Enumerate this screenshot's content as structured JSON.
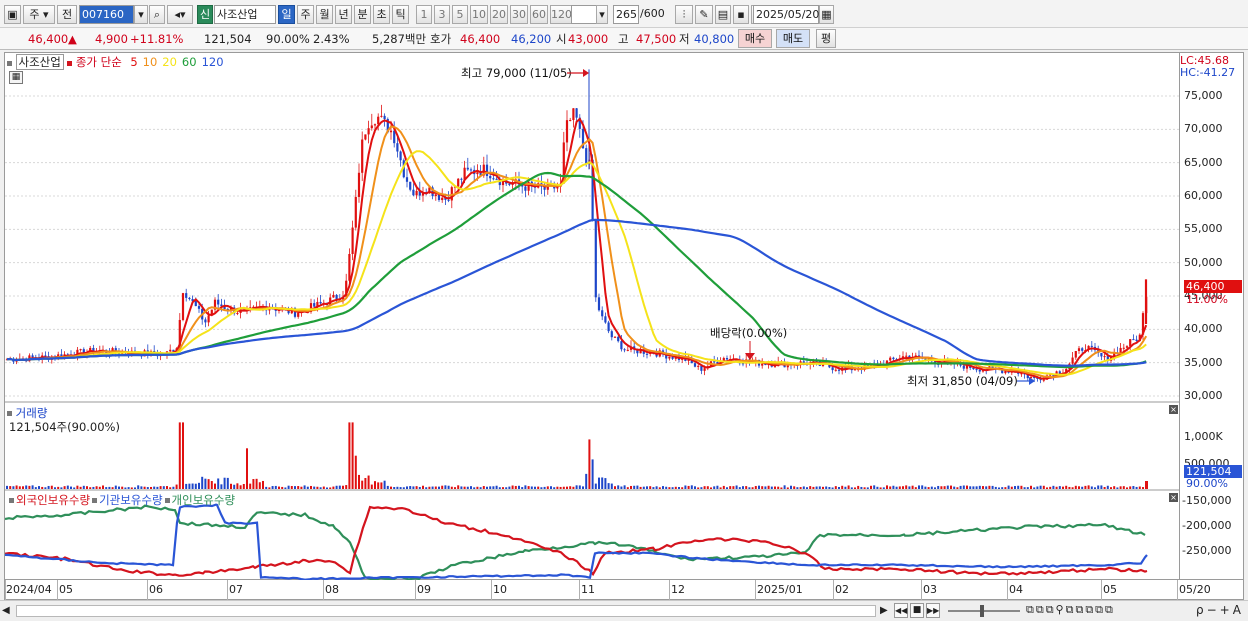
{
  "toolbar": {
    "type_label": "주",
    "prev_label": "전",
    "code": "007160",
    "stock_badge": "신",
    "stock_name": "사조산업",
    "periods": [
      "일",
      "주",
      "월",
      "년",
      "분",
      "초",
      "틱"
    ],
    "active_period": "일",
    "intervals": [
      "1",
      "3",
      "5",
      "10",
      "20",
      "30",
      "60",
      "120"
    ],
    "count": "265",
    "count_total": "/600",
    "date": "2025/05/20"
  },
  "quote": {
    "price": "46,400",
    "change": "4,900",
    "change_pct": "+11.81%",
    "volume": "121,504",
    "vol_ratio": "90.00%",
    "turnover": "2.43%",
    "amount": "5,287백만",
    "ask_label": "호가",
    "ask": "46,400",
    "bid": "46,200",
    "open_label": "시",
    "open": "43,000",
    "high_label": "고",
    "high": "47,500",
    "low_label": "저",
    "low": "40,800",
    "buy_label": "매수",
    "sell_label": "매도",
    "eval_label": "평"
  },
  "price_panel": {
    "name_tag": "사조산업",
    "ma_title": "종가 단순",
    "ma_periods": [
      "5",
      "10",
      "20",
      "60",
      "120"
    ],
    "ma_colors": [
      "#e01010",
      "#f0901a",
      "#f5e31a",
      "#1f9e3a",
      "#2a55d6"
    ],
    "lc": "LC:45.68",
    "hc": "HC:-41.27",
    "high_annot": "최고 79,000 (11/05)",
    "low_annot": "최저 31,850 (04/09)",
    "dividend_annot": "배당락(0.00%)",
    "y_ticks": [
      "75,000",
      "70,000",
      "65,000",
      "60,000",
      "55,000",
      "50,000",
      "45,000",
      "40,000",
      "35,000",
      "30,000"
    ],
    "last_price_tag": "46,400",
    "last_pct_tag": "11.00%"
  },
  "volume_panel": {
    "title": "거래량",
    "value": "121,504주(90.00%)",
    "y_ticks": [
      "1,000K",
      "500,000"
    ],
    "last_tag": "121,504",
    "last_pct_tag": "90.00%"
  },
  "holdings_panel": {
    "legend": [
      "외국인보유수량",
      "기관보유수량",
      "개인보유수량"
    ],
    "legend_colors": [
      "#d4141e",
      "#2a55d6",
      "#2f8f5a"
    ],
    "y_ticks": [
      "-150,000",
      "-200,000",
      "-250,000"
    ]
  },
  "x_labels": [
    "2024/04",
    "05",
    "06",
    "07",
    "08",
    "09",
    "10",
    "11",
    "12",
    "2025/01",
    "02",
    "03",
    "04",
    "05",
    "05/20"
  ],
  "chart_data": {
    "type": "candlestick",
    "x_range": [
      "2024/04",
      "2025/05/20"
    ],
    "ylim": [
      30000,
      80000
    ],
    "annotations": {
      "high": 79000,
      "high_date": "11/05",
      "low": 31850,
      "low_date": "04/09"
    },
    "close_series": [
      {
        "date": "2024/04",
        "close": 35500
      },
      {
        "date": "2024/05",
        "close": 36500
      },
      {
        "date": "2024/06",
        "close": 37000
      },
      {
        "date": "2024/06b",
        "close": 46000
      },
      {
        "date": "2024/07",
        "close": 43000
      },
      {
        "date": "2024/07b",
        "close": 42500
      },
      {
        "date": "2024/08",
        "close": 45000
      },
      {
        "date": "2024/08b",
        "close": 71000
      },
      {
        "date": "2024/09",
        "close": 60000
      },
      {
        "date": "2024/09b",
        "close": 64000
      },
      {
        "date": "2024/10",
        "close": 62000
      },
      {
        "date": "2024/10b",
        "close": 61500
      },
      {
        "date": "2024/11",
        "close": 73000
      },
      {
        "date": "2024/11b",
        "close": 40000
      },
      {
        "date": "2024/12",
        "close": 36000
      },
      {
        "date": "2025/01",
        "close": 34500
      },
      {
        "date": "2025/02",
        "close": 34000
      },
      {
        "date": "2025/03",
        "close": 35500
      },
      {
        "date": "2025/04",
        "close": 33000
      },
      {
        "date": "2025/05",
        "close": 38000
      },
      {
        "date": "2025/05/20",
        "close": 46400
      }
    ],
    "volume_peak": 1400000,
    "volume_last": 121504
  }
}
